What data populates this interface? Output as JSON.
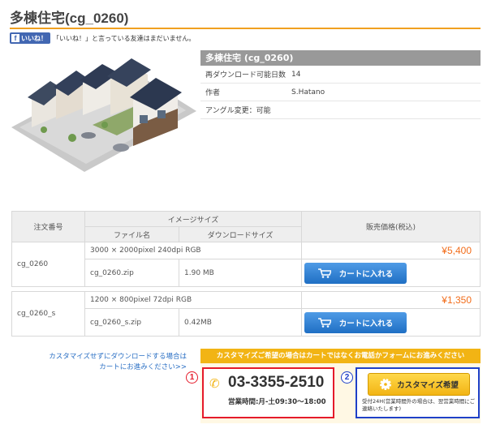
{
  "page": {
    "title": "多棟住宅(cg_0260)"
  },
  "social": {
    "like_label": "いいね！",
    "like_text": "「いいね！」と言っている友達はまだいません。"
  },
  "product": {
    "title": "多棟住宅 (cg_0260)",
    "rows": [
      {
        "label": "再ダウンロード可能日数",
        "value": "14"
      },
      {
        "label": "作者",
        "value": "S.Hatano"
      },
      {
        "label": "アングル変更：可能",
        "value": ""
      }
    ]
  },
  "table": {
    "header": {
      "order_no": "注文番号",
      "image_size": "イメージサイズ",
      "price": "販売価格(税込)",
      "file_name": "ファイル名",
      "download_size": "ダウンロードサイズ"
    },
    "items": [
      {
        "order_no": "cg_0260",
        "spec": "3000 × 2000pixel 240dpi RGB",
        "price": "¥5,400",
        "file": "cg_0260.zip",
        "size": "1.90 MB",
        "cart_label": "カートに入れる"
      },
      {
        "order_no": "cg_0260_s",
        "spec": "1200 × 800pixel 72dpi RGB",
        "price": "¥1,350",
        "file": "cg_0260_s.zip",
        "size": "0.42MB",
        "cart_label": "カートに入れる"
      }
    ]
  },
  "custom": {
    "link_line1": "カスタマイズせずにダウンロードする場合は",
    "link_line2": "カートにお進みください>>",
    "header": "カスタマイズご希望の場合はカートではなくお電話かフォームにお進みください",
    "badge1": "1",
    "badge2": "2",
    "phone": "03-3355-2510",
    "hours": "営業時間:月-土09:30〜18:00",
    "button_label": "カスタマイズ希望",
    "note": "受付24H(営業時間外の場合は、翌営業時間にご連絡いたします)"
  },
  "colors": {
    "accent": "#f2b414",
    "price": "#f26d1b",
    "cart_button": "#2b7fd4",
    "phone_border": "#e51a2a",
    "custom_border": "#1e40c8"
  }
}
